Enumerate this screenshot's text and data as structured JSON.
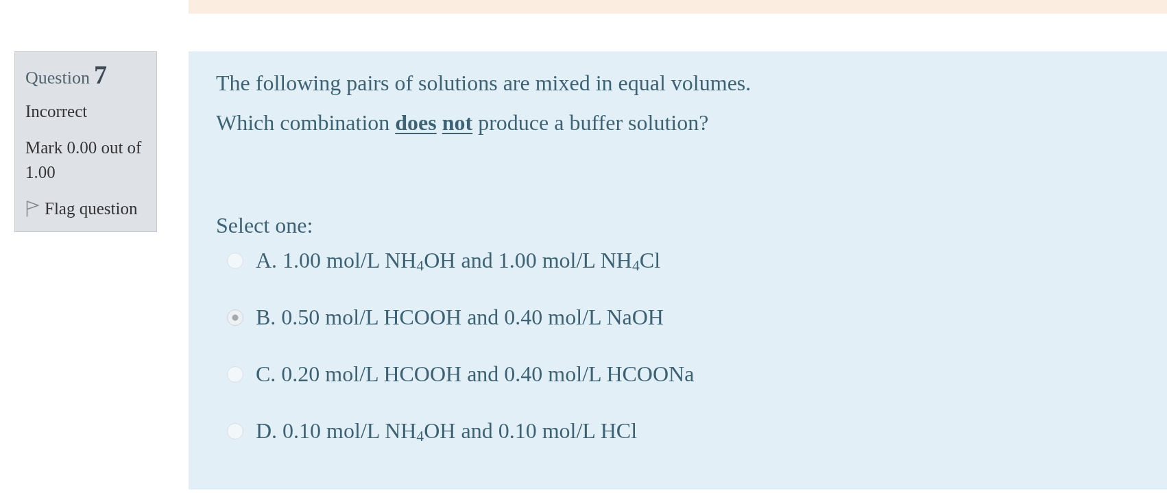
{
  "question_info": {
    "label": "Question",
    "number": "7",
    "state": "Incorrect",
    "grade": "Mark 0.00 out of 1.00",
    "flag": {
      "label": "Flag question",
      "flagged": false
    }
  },
  "question": {
    "text": [
      "The following pairs of solutions are mixed in equal volumes.",
      "Which combination **does** **not** produce a buffer solution?"
    ],
    "prompt": "Select one:",
    "options": [
      {
        "letter": "A.",
        "text": "1.00 mol/L NH$_{4}$OH and 1.00 mol/L NH$_{4}$Cl",
        "selected": false
      },
      {
        "letter": "B.",
        "text": "0.50 mol/L HCOOH and 0.40 mol/L NaOH",
        "selected": true
      },
      {
        "letter": "C.",
        "text": "0.20 mol/L HCOOH and 0.40 mol/L HCOONa",
        "selected": false
      },
      {
        "letter": "D.",
        "text": "0.10 mol/L NH$_{4}$OH and 0.10 mol/L HCl",
        "selected": false
      }
    ]
  }
}
